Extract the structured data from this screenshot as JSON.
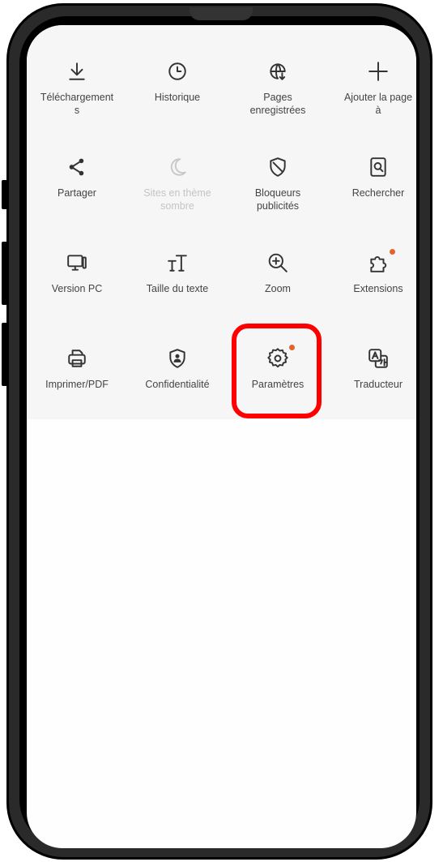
{
  "menu": {
    "items": [
      {
        "label": "Téléchargement\ns",
        "icon": "download-icon"
      },
      {
        "label": "Historique",
        "icon": "clock-icon"
      },
      {
        "label": "Pages\nenregistrées",
        "icon": "globe-download-icon"
      },
      {
        "label": "Ajouter la page\nà",
        "icon": "plus-icon"
      },
      {
        "label": "Partager",
        "icon": "share-icon"
      },
      {
        "label": "Sites en thème\nsombre",
        "icon": "moon-icon",
        "disabled": true
      },
      {
        "label": "Bloqueurs\npublicités",
        "icon": "shield-slash-icon"
      },
      {
        "label": "Rechercher",
        "icon": "find-in-page-icon"
      },
      {
        "label": "Version PC",
        "icon": "desktop-icon"
      },
      {
        "label": "Taille du texte",
        "icon": "text-size-icon"
      },
      {
        "label": "Zoom",
        "icon": "zoom-in-icon"
      },
      {
        "label": "Extensions",
        "icon": "puzzle-icon",
        "badge": true
      },
      {
        "label": "Imprimer/PDF",
        "icon": "printer-icon"
      },
      {
        "label": "Confidentialité",
        "icon": "privacy-shield-icon"
      },
      {
        "label": "Paramètres",
        "icon": "gear-icon",
        "badge": true,
        "highlighted": true
      },
      {
        "label": "Traducteur",
        "icon": "translate-icon"
      }
    ]
  },
  "colors": {
    "accent_badge": "#e3642a",
    "highlight": "#ff0000",
    "panel_background": "#f6f6f6"
  }
}
